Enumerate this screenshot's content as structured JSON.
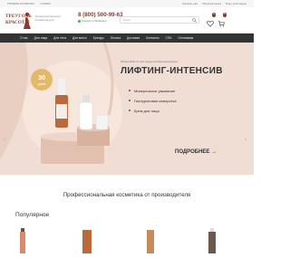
{
  "topbar": {
    "links": [
      "ТРЮФЕЛЬ КОСМЕТИКА",
      "ССЫЛКИ"
    ],
    "right": [
      "Написать нам",
      "Обратный звонок",
      "Вход | регистрация"
    ]
  },
  "header": {
    "logo_lines": [
      "ТРЕУГОЛЬ",
      "КРАСОТЫ"
    ],
    "tagline": "Профессиональная косметика для...",
    "phone": "8 (800) 500-99-63",
    "phone_sub": "Telegram и WhatsApp",
    "search_placeholder": "Поиск",
    "cart_counts": [
      "0",
      "0"
    ]
  },
  "nav": {
    "items": [
      "О нас",
      "Для лица",
      "Для тела",
      "Для волос",
      "Бренды",
      "Оплата",
      "Доставка",
      "Контакты",
      "СПА",
      "Оптовикам"
    ]
  },
  "banner": {
    "sticker_number": "30",
    "sticker_unit": "дней",
    "note": "Физиум Фейс из трех продуктов Кератоинтерацию",
    "title": "ЛИФТИНГ-ИНТЕНСИВ",
    "items": [
      "Минеральное умывание",
      "Гиалуроновая сыворотка",
      "Крем для лица"
    ],
    "more": "ПОДРОБНЕЕ",
    "colors": {
      "bg": "#f0ddd3",
      "sticker": "#e2b96a",
      "accent": "#8a3a2e"
    }
  },
  "sections": {
    "title": "Профессиональная косметика от производителя",
    "popular": "Популярное"
  }
}
